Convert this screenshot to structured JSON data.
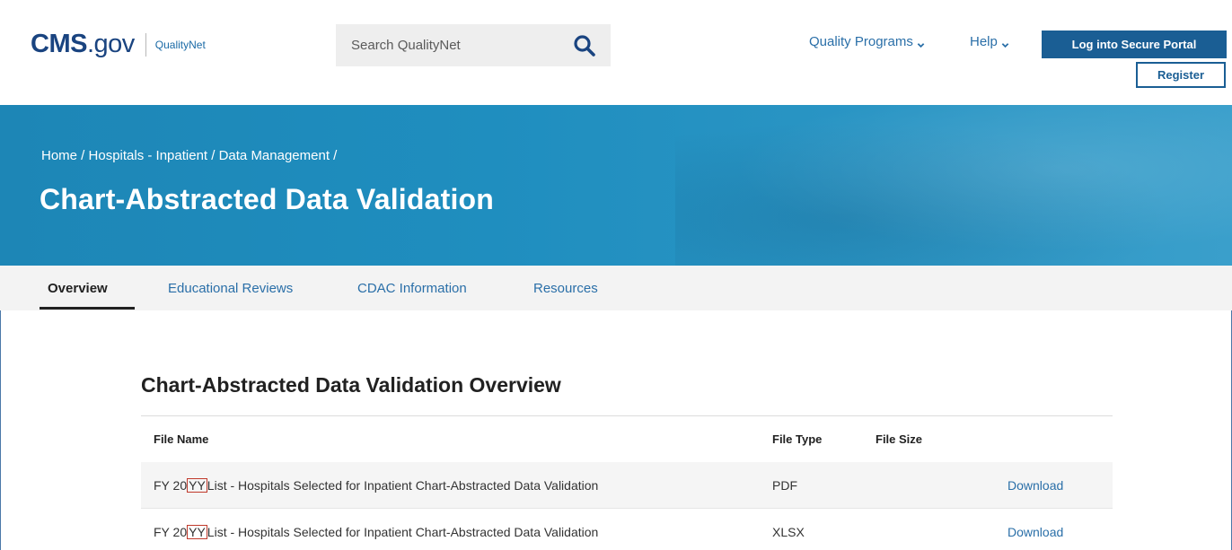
{
  "header": {
    "logo": {
      "cms": "CMS",
      "gov": ".gov",
      "product": "QualityNet"
    },
    "search": {
      "placeholder": "Search QualityNet",
      "icon": "search-icon"
    },
    "nav": [
      {
        "label": "Quality Programs",
        "icon": "chevron-down-icon"
      },
      {
        "label": "Help",
        "icon": "chevron-down-icon"
      }
    ],
    "login_label": "Log into Secure Portal",
    "register_label": "Register"
  },
  "hero": {
    "breadcrumb": "Home / Hospitals - Inpatient / Data Management /",
    "title": "Chart-Abstracted Data Validation"
  },
  "tabs": [
    {
      "label": "Overview",
      "active": true
    },
    {
      "label": "Educational Reviews",
      "active": false
    },
    {
      "label": "CDAC Information",
      "active": false
    },
    {
      "label": "Resources",
      "active": false
    }
  ],
  "main": {
    "section_title": "Chart-Abstracted Data Validation Overview",
    "table": {
      "headers": [
        "File Name",
        "File Type",
        "File Size",
        ""
      ],
      "rows": [
        {
          "name_prefix": "FY 20",
          "name_highlight": "YY",
          "name_suffix": " List - Hospitals Selected for Inpatient Chart-Abstracted Data Validation",
          "type": "PDF",
          "size": "",
          "action": "Download"
        },
        {
          "name_prefix": "FY 20",
          "name_highlight": "YY",
          "name_suffix": " List - Hospitals Selected for Inpatient Chart-Abstracted Data Validation",
          "type": "XLSX",
          "size": "",
          "action": "Download"
        }
      ]
    }
  },
  "colors": {
    "brand_navy": "#1a4480",
    "link_blue": "#2a6fa8",
    "button_blue": "#1a5e94",
    "hero_blue": "#1f8ebf"
  }
}
